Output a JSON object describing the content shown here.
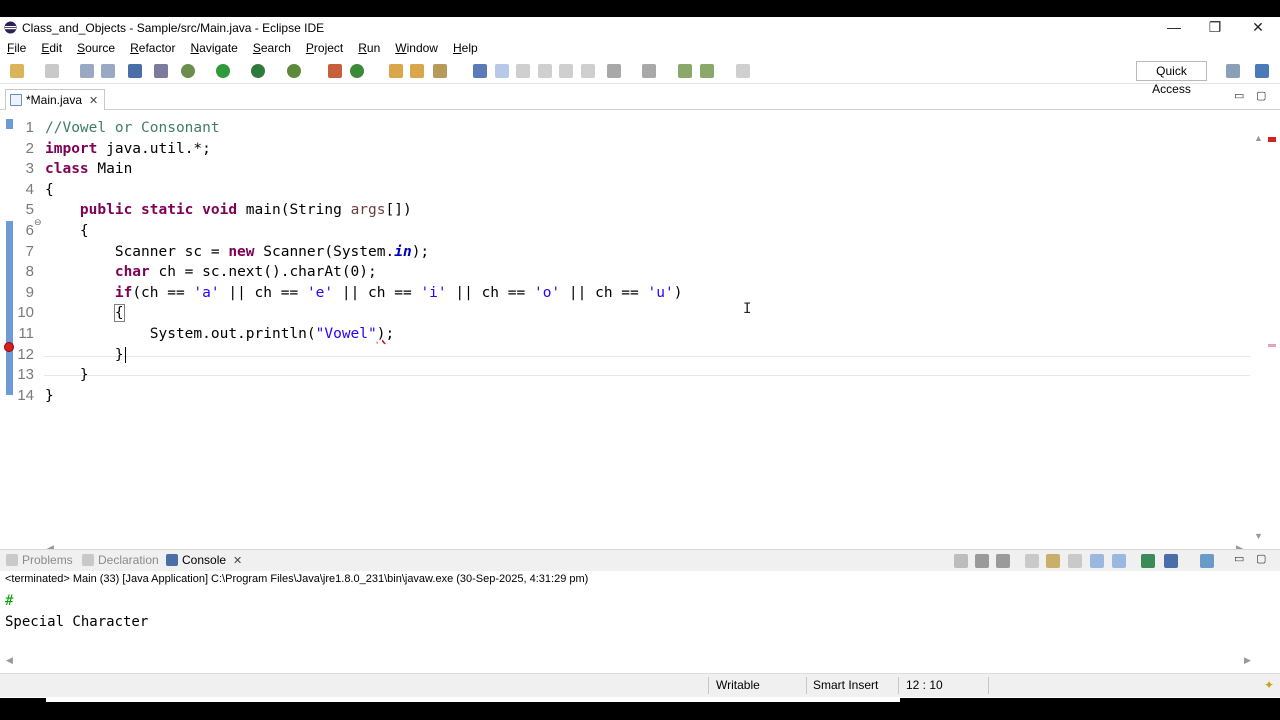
{
  "window": {
    "title": "Class_and_Objects - Sample/src/Main.java - Eclipse IDE",
    "minimize": "—",
    "restore": "❐",
    "close": "✕"
  },
  "menu": [
    "File",
    "Edit",
    "Source",
    "Refactor",
    "Navigate",
    "Search",
    "Project",
    "Run",
    "Window",
    "Help"
  ],
  "toolbar": {
    "quick_access": "Quick Access"
  },
  "editor": {
    "tab_label": "*Main.java",
    "tab_close": "✕",
    "line_numbers": [
      "1",
      "2",
      "3",
      "4",
      "5",
      "6",
      "7",
      "8",
      "9",
      "10",
      "11",
      "12",
      "13",
      "14"
    ],
    "cursor": "12:10"
  },
  "code": {
    "l1_comment": "//Vowel or Consonant",
    "l2_kw": "import",
    "l2_rest": " java.util.*;",
    "l3_kw": "class",
    "l3_rest": " Main",
    "l4": "{",
    "l5_indent": "    ",
    "l5_kw": "public static void",
    "l5_rest": " main(String ",
    "l5_arg": "args",
    "l5_end": "[])",
    "l6": "    {",
    "l7_pre": "        Scanner sc = ",
    "l7_kw": "new",
    "l7_mid": " Scanner(System.",
    "l7_in": "in",
    "l7_end": ");",
    "l8_indent": "        ",
    "l8_kw": "char",
    "l8_rest": " ch = sc.next().charAt(0);",
    "l9_indent": "        ",
    "l9_kw": "if",
    "l9_p1": "(ch == ",
    "l9_a": "'a'",
    "l9_p2": " || ch == ",
    "l9_e": "'e'",
    "l9_p3": " || ch == ",
    "l9_i": "'i'",
    "l9_p4": " || ch == ",
    "l9_o": "'o'",
    "l9_p5": " || ch == ",
    "l9_u": "'u'",
    "l9_end": ")",
    "l10_indent": "        ",
    "l10": "{",
    "l11_pre": "            System.out.println(",
    "l11_str": "\"Vowel\"",
    "l11_err": ")",
    "l11_end": ";",
    "l12_indent": "        ",
    "l12": "}",
    "l13": "    }",
    "l14": "}"
  },
  "panel": {
    "tabs": [
      {
        "label": "Problems",
        "active": false
      },
      {
        "label": "Declaration",
        "active": false
      },
      {
        "label": "Console",
        "active": true
      }
    ],
    "console_close": "✕",
    "terminated_info": "<terminated> Main (33) [Java Application] C:\\Program Files\\Java\\jre1.8.0_231\\bin\\javaw.exe (30-Sep-2025, 4:31:29 pm)",
    "console_input": "#",
    "console_output": "Special Character"
  },
  "status": {
    "writable": "Writable",
    "insert_mode": "Smart Insert",
    "position": "12 : 10"
  },
  "colors": {
    "keyword": "#7f0055",
    "comment": "#3f7f5f",
    "string": "#2a00ff",
    "static_field": "#0000c0",
    "console_input": "#00a000",
    "ruler": "#6c9bd8",
    "error": "#d32020"
  },
  "icons": {
    "app": "eclipse-icon",
    "file": "java-file-icon",
    "error": "error-marker-icon"
  }
}
